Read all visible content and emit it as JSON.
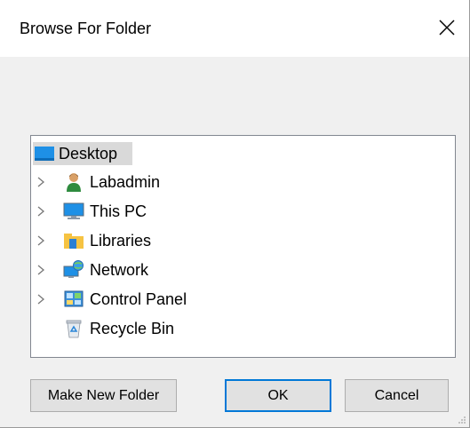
{
  "window": {
    "title": "Browse For Folder"
  },
  "tree": {
    "items": [
      {
        "label": "Desktop",
        "icon": "desktop-icon",
        "expandable": false,
        "selected": true
      },
      {
        "label": "Labadmin",
        "icon": "user-icon",
        "expandable": true,
        "selected": false
      },
      {
        "label": "This PC",
        "icon": "computer-icon",
        "expandable": true,
        "selected": false
      },
      {
        "label": "Libraries",
        "icon": "libraries-icon",
        "expandable": true,
        "selected": false
      },
      {
        "label": "Network",
        "icon": "network-icon",
        "expandable": true,
        "selected": false
      },
      {
        "label": "Control Panel",
        "icon": "control-panel-icon",
        "expandable": true,
        "selected": false
      },
      {
        "label": "Recycle Bin",
        "icon": "recycle-bin-icon",
        "expandable": false,
        "selected": false
      }
    ]
  },
  "buttons": {
    "make_new_folder": "Make New Folder",
    "ok": "OK",
    "cancel": "Cancel"
  },
  "colors": {
    "selection": "#d9d9d9",
    "default_button_border": "#0078d7",
    "desktop_blue": "#1e90e6"
  }
}
